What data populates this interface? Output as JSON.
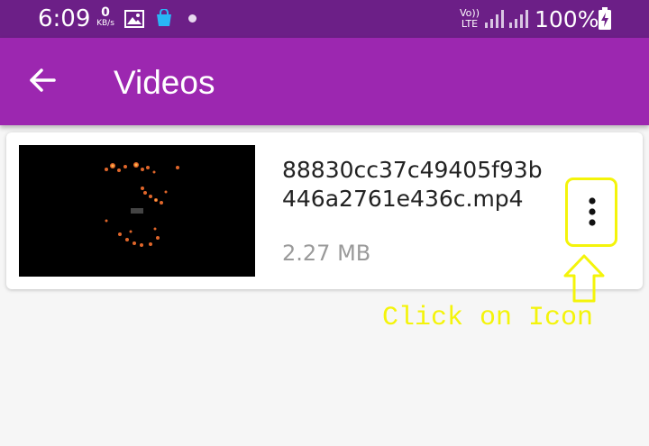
{
  "status_bar": {
    "time": "6:09",
    "net_speed_value": "0",
    "net_speed_unit": "KB/s",
    "volte_top": "Vo))",
    "volte_bottom": "LTE",
    "battery": "100%"
  },
  "app_bar": {
    "title": "Videos",
    "back_icon": "arrow-left-icon"
  },
  "video_item": {
    "file_name": "88830cc37c49405f93b446a2761e436c.mp4",
    "file_size": "2.27 MB",
    "menu_icon": "more-vert-icon"
  },
  "annotation": {
    "text": "Click on Icon",
    "color": "#f4f40a"
  },
  "colors": {
    "status_bar": "#6c1f87",
    "app_bar": "#9c27b0",
    "background": "#f6f6f6"
  }
}
